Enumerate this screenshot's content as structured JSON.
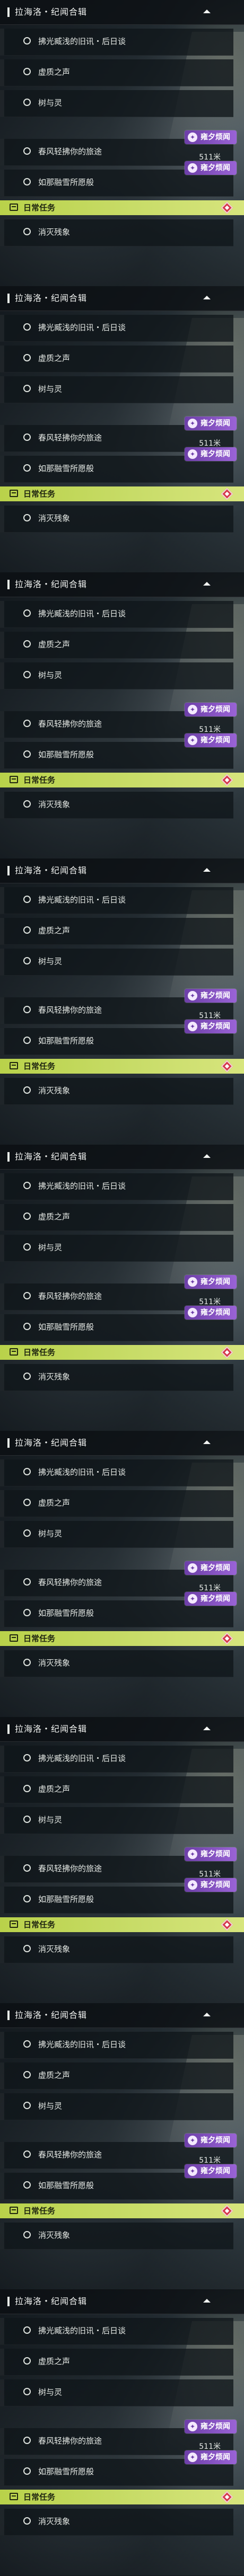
{
  "panel": {
    "title": "拉海洛・纪闻合辑",
    "quests": [
      "拂光臧浅的旧讯・后日谈",
      "虚质之声",
      "树与灵",
      "春风轻拂你的旅途",
      "如那融雪所愿般"
    ],
    "quest_progress": "511米",
    "badge_label": "雍夕烦闻",
    "daily_label": "日常任务",
    "daily_quest": "消灭残象"
  },
  "screens": [
    {
      "index": 1
    },
    {
      "index": 2
    },
    {
      "index": 3
    },
    {
      "index": 4
    },
    {
      "index": 5
    },
    {
      "index": 6
    },
    {
      "index": 7
    },
    {
      "index": 8
    },
    {
      "index": 9
    }
  ],
  "icons": {
    "collapse": "chevron-up-icon",
    "radio": "radio-circle-icon",
    "badge": "event-badge-icon",
    "daily": "daily-task-icon",
    "marker": "diamond-marker-icon"
  },
  "colors": {
    "daily_bar": "#c8dc68",
    "badge": "#8a55c8",
    "marker": "#d5384a"
  }
}
